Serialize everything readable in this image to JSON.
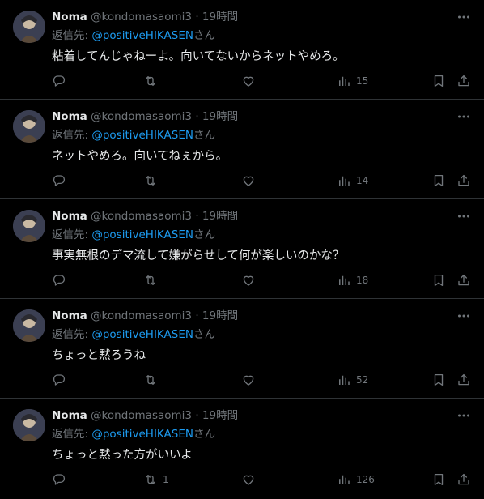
{
  "tweets": [
    {
      "name": "Noma",
      "handle": "@kondomasaomi3",
      "separator": "·",
      "time": "19時間",
      "reply_prefix": "返信先: ",
      "reply_mention": "@positiveHIKASEN",
      "reply_suffix": "さん",
      "text": "粘着してんじゃねーよ。向いてないからネットやめろ。",
      "retweets": "",
      "views": "15"
    },
    {
      "name": "Noma",
      "handle": "@kondomasaomi3",
      "separator": "·",
      "time": "19時間",
      "reply_prefix": "返信先: ",
      "reply_mention": "@positiveHIKASEN",
      "reply_suffix": "さん",
      "text": "ネットやめろ。向いてねぇから。",
      "retweets": "",
      "views": "14"
    },
    {
      "name": "Noma",
      "handle": "@kondomasaomi3",
      "separator": "·",
      "time": "19時間",
      "reply_prefix": "返信先: ",
      "reply_mention": "@positiveHIKASEN",
      "reply_suffix": "さん",
      "text": "事実無根のデマ流して嫌がらせして何が楽しいのかな？",
      "retweets": "",
      "views": "18"
    },
    {
      "name": "Noma",
      "handle": "@kondomasaomi3",
      "separator": "·",
      "time": "19時間",
      "reply_prefix": "返信先: ",
      "reply_mention": "@positiveHIKASEN",
      "reply_suffix": "さん",
      "text": "ちょっと黙ろうね",
      "retweets": "",
      "views": "52"
    },
    {
      "name": "Noma",
      "handle": "@kondomasaomi3",
      "separator": "·",
      "time": "19時間",
      "reply_prefix": "返信先: ",
      "reply_mention": "@positiveHIKASEN",
      "reply_suffix": "さん",
      "text": "ちょっと黙った方がいいよ",
      "retweets": "1",
      "views": "126"
    }
  ],
  "icons": {
    "more": "more-dots-icon",
    "reply": "reply-bubble-icon",
    "retweet": "retweet-icon",
    "like": "heart-icon",
    "views": "views-bars-icon",
    "bookmark": "bookmark-icon",
    "share": "share-icon"
  },
  "colors": {
    "background": "#000000",
    "text": "#e7e9ea",
    "muted": "#71767b",
    "mention": "#1d9bf0",
    "divider": "#2f3336"
  }
}
